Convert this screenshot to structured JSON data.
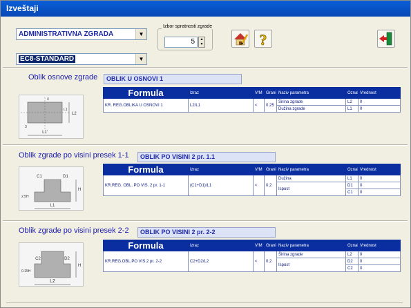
{
  "title": "Izveštaji",
  "combo1": "ADMINISTRATIVNA ZGRADA",
  "combo2": "EC8-STANDARD",
  "spin": {
    "label": "Izbor spratnosti zgrade",
    "value": "5"
  },
  "headers": {
    "formula": "Formula",
    "izraz": "Izraz",
    "vm": "V/M",
    "granica": "Granica",
    "naziv": "Naziv parametra",
    "oznaka": "Oznaka",
    "vrednost": "Vrednost"
  },
  "sections": [
    {
      "label": "Oblik osnove zgrade",
      "name": "OBLIK U OSNOVI 1",
      "row_label": "KR. REG.OBLIKA U OSNOVI 1",
      "izraz": "L2/L1",
      "vm": "<",
      "granica": "0.25",
      "params": [
        {
          "naziv": "Širina zgrade",
          "oznaka": "L2",
          "vrednost": "0"
        },
        {
          "naziv": "Dužina zgrade",
          "oznaka": "L1",
          "vrednost": "0"
        }
      ],
      "dims": {
        "a": "L2",
        "b": "L1",
        "c": "L1'",
        "d": "4",
        "e": "3"
      }
    },
    {
      "label": "Oblik zgrade po visini presek 1-1",
      "name": "OBLIK PO VISINI 2 pr. 1.1",
      "row_label": "KR.REG. OBL. PO VIS. 2 pr. 1-1",
      "izraz": "(C1+D1)/L1",
      "vm": "<",
      "granica": "0.2",
      "params": [
        {
          "naziv": "Dužina",
          "oznaka": "L1",
          "vrednost": "0"
        },
        {
          "naziv": "Ispust",
          "oznaka": "D1",
          "vrednost": "0"
        },
        {
          "naziv": "",
          "oznaka": "C1",
          "vrednost": "0"
        }
      ],
      "dims": {
        "a": "C1",
        "b": "D1",
        "c": "L1",
        "d": "H",
        "e": "2.5H"
      }
    },
    {
      "label": "Oblik zgrade po visini presek 2-2",
      "name": "OBLIK PO VISINI 2 pr. 2-2",
      "row_label": "KR.REG.OBL.PO VIS.2 pr. 2-2",
      "izraz": "C2+D2/L2",
      "vm": "<",
      "granica": "0.2",
      "params": [
        {
          "naziv": "Širina zgrade",
          "oznaka": "L2",
          "vrednost": "0"
        },
        {
          "naziv": "Ispust",
          "oznaka": "D2",
          "vrednost": "0"
        },
        {
          "naziv": "",
          "oznaka": "C2",
          "vrednost": "0"
        }
      ],
      "dims": {
        "a": "C2",
        "b": "D2",
        "c": "L2",
        "d": "H",
        "e": "0.15H"
      }
    }
  ]
}
